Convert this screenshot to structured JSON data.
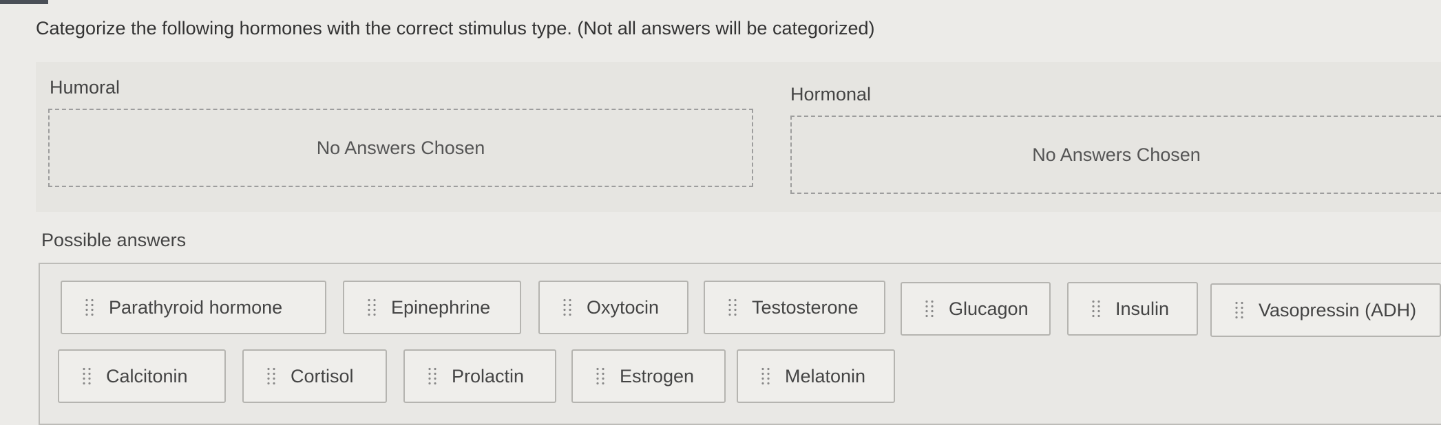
{
  "question": "Categorize the following hormones with the correct stimulus type. (Not all answers will be categorized)",
  "categories": [
    {
      "title": "Humoral",
      "empty_text": "No Answers Chosen"
    },
    {
      "title": "Hormonal",
      "empty_text": "No Answers Chosen"
    }
  ],
  "possible_answers_title": "Possible answers",
  "answers": [
    "Parathyroid hormone",
    "Epinephrine",
    "Oxytocin",
    "Testosterone",
    "Glucagon",
    "Insulin",
    "Vasopressin (ADH)",
    "Calcitonin",
    "Cortisol",
    "Prolactin",
    "Estrogen",
    "Melatonin"
  ],
  "icons": {
    "drag_handle": "drag-handle-icon"
  }
}
